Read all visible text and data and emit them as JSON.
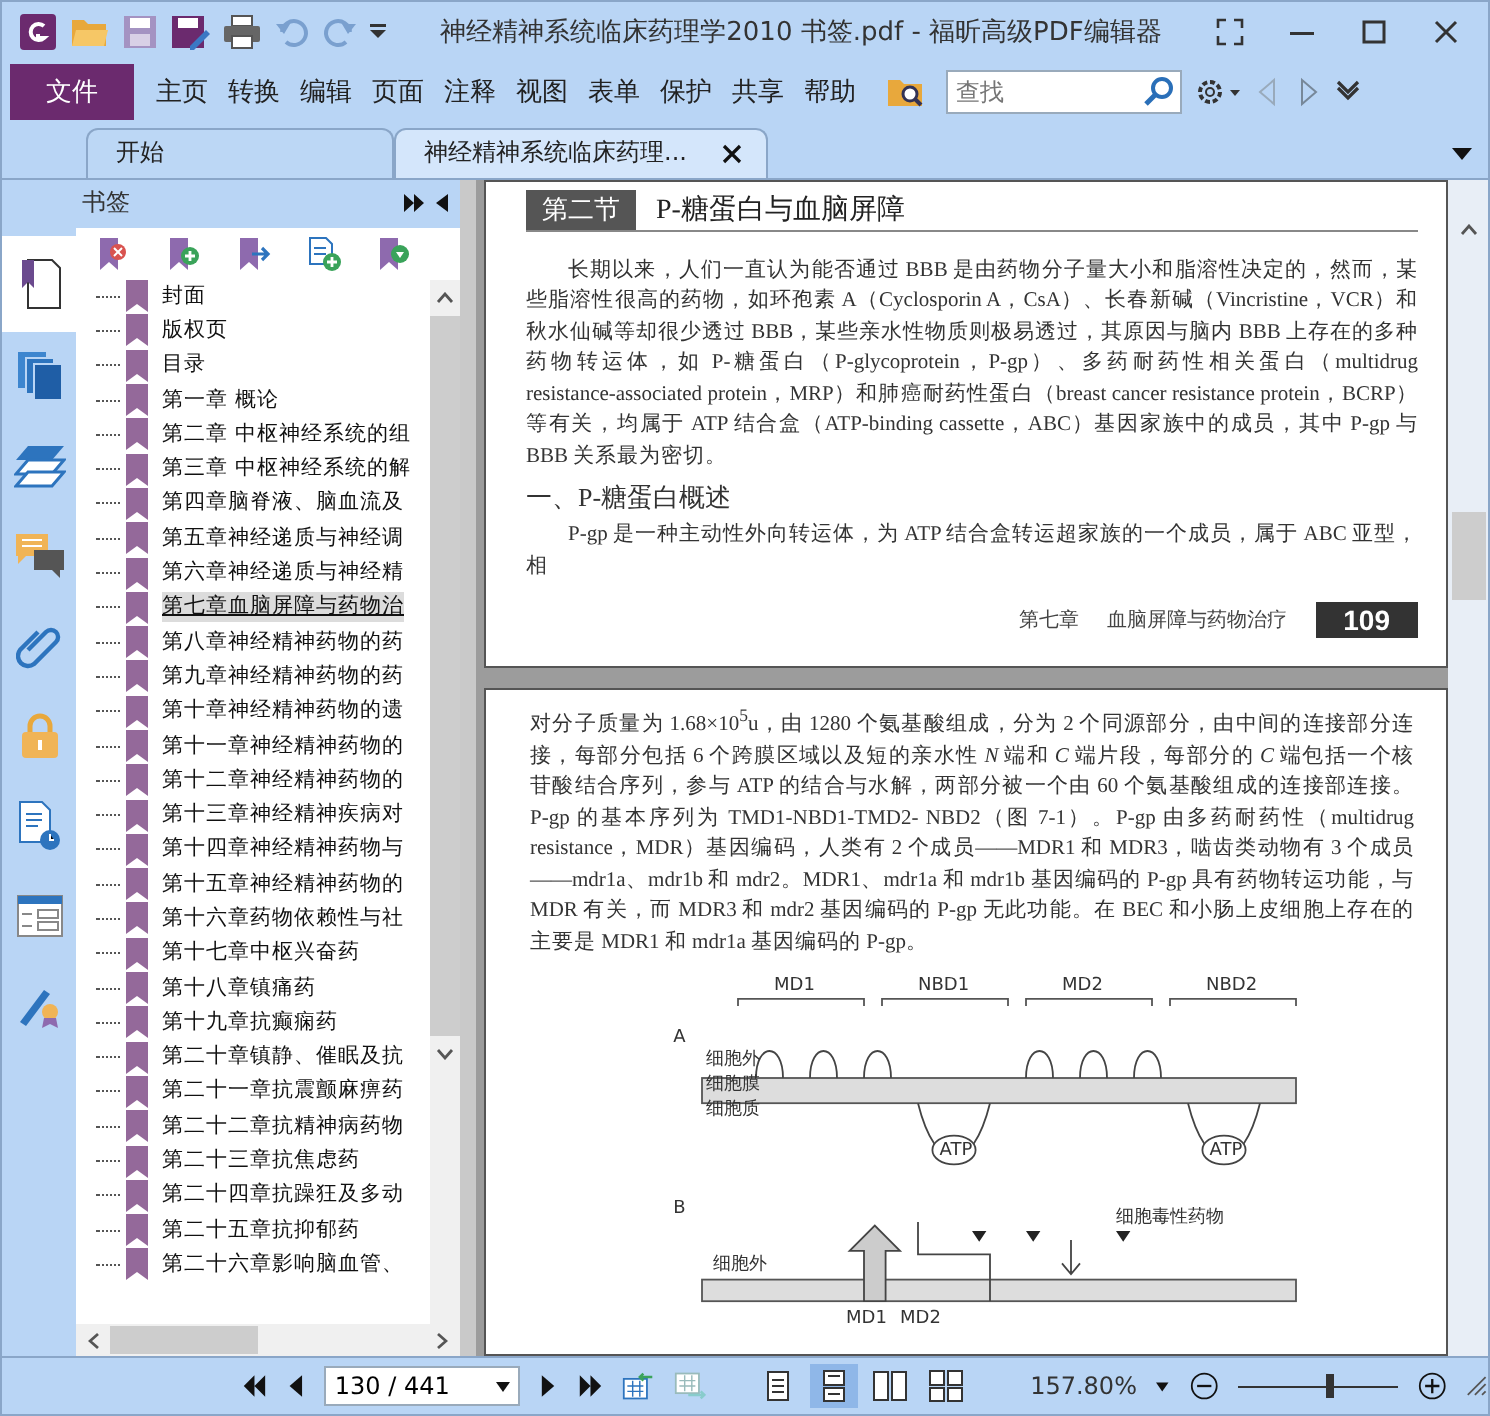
{
  "window": {
    "title": "神经精神系统临床药理学2010 书签.pdf - 福昕高级PDF编辑器"
  },
  "ribbon": {
    "file_button": "文件",
    "menus": [
      "主页",
      "转换",
      "编辑",
      "页面",
      "注释",
      "视图",
      "表单",
      "保护",
      "共享",
      "帮助"
    ]
  },
  "search": {
    "placeholder": "查找"
  },
  "tabs": [
    {
      "label": "开始",
      "selected": false,
      "closable": false
    },
    {
      "label": "神经精神系统临床药理...",
      "selected": true,
      "closable": true
    }
  ],
  "sidebar": {
    "title": "书签",
    "panels": [
      {
        "kind": "bookmarks",
        "selected": true
      },
      {
        "kind": "pages",
        "selected": false
      },
      {
        "kind": "layers",
        "selected": false
      },
      {
        "kind": "comments",
        "selected": false
      },
      {
        "kind": "attachments",
        "selected": false
      },
      {
        "kind": "security",
        "selected": false
      },
      {
        "kind": "history",
        "selected": false
      },
      {
        "kind": "form",
        "selected": false
      },
      {
        "kind": "signature",
        "selected": false
      }
    ],
    "bookmarks": [
      {
        "label": "封面",
        "selected": false
      },
      {
        "label": "版权页",
        "selected": false
      },
      {
        "label": "目录",
        "selected": false
      },
      {
        "label": "第一章 概论",
        "selected": false
      },
      {
        "label": "第二章 中枢神经系统的组",
        "selected": false
      },
      {
        "label": "第三章 中枢神经系统的解",
        "selected": false
      },
      {
        "label": "第四章脑脊液、脑血流及",
        "selected": false
      },
      {
        "label": "第五章神经递质与神经调",
        "selected": false
      },
      {
        "label": "第六章神经递质与神经精",
        "selected": false
      },
      {
        "label": "第七章血脑屏障与药物治",
        "selected": true
      },
      {
        "label": "第八章神经精神药物的药",
        "selected": false
      },
      {
        "label": "第九章神经精神药物的药",
        "selected": false
      },
      {
        "label": "第十章神经精神药物的遗",
        "selected": false
      },
      {
        "label": "第十一章神经精神药物的",
        "selected": false
      },
      {
        "label": "第十二章神经精神药物的",
        "selected": false
      },
      {
        "label": "第十三章神经精神疾病对",
        "selected": false
      },
      {
        "label": "第十四章神经精神药物与",
        "selected": false
      },
      {
        "label": "第十五章神经精神药物的",
        "selected": false
      },
      {
        "label": "第十六章药物依赖性与社",
        "selected": false
      },
      {
        "label": "第十七章中枢兴奋药",
        "selected": false
      },
      {
        "label": "第十八章镇痛药",
        "selected": false
      },
      {
        "label": "第十九章抗癫痫药",
        "selected": false
      },
      {
        "label": "第二十章镇静、催眠及抗",
        "selected": false
      },
      {
        "label": "第二十一章抗震颤麻痹药",
        "selected": false
      },
      {
        "label": "第二十二章抗精神病药物",
        "selected": false
      },
      {
        "label": "第二十三章抗焦虑药",
        "selected": false
      },
      {
        "label": "第二十四章抗躁狂及多动",
        "selected": false
      },
      {
        "label": "第二十五章抗抑郁药",
        "selected": false
      },
      {
        "label": "第二十六章影响脑血管、",
        "selected": false
      }
    ]
  },
  "document": {
    "page_1": {
      "section_tag": "第二节",
      "section_title": "P-糖蛋白与血脑屏障",
      "paragraph": "长期以来，人们一直认为能否通过 BBB 是由药物分子量大小和脂溶性决定的，然而，某些脂溶性很高的药物，如环孢素 A（Cyclosporin A，CsA）、长春新碱（Vincristine，VCR）和秋水仙碱等却很少透过 BBB，某些亲水性物质则极易透过，其原因与脑内 BBB 上存在的多种药物转运体，如 P-糖蛋白（P-glycoprotein，P-gp）、多药耐药性相关蛋白（multidrug resistance-associated protein，MRP）和肺癌耐药性蛋白（breast cancer resistance protein，BCRP）等有关，均属于 ATP 结合盒（ATP-binding cassette，ABC）基因家族中的成员，其中 P-gp 与 BBB 关系最为密切。",
      "subheading": "一、P-糖蛋白概述",
      "paragraph_2": "P-gp 是一种主动性外向转运体，为 ATP 结合盒转运超家族的一个成员，属于 ABC 亚型，相",
      "footer_chapter": "第七章",
      "footer_title": "血脑屏障与药物治疗",
      "page_number": "109"
    },
    "page_2": {
      "paragraph": "对分子质量为 1.68×10$^{5}$u，由 1280 个氨基酸组成，分为 2 个同源部分，由中间的连接部分连接，每部分包括 6 个跨膜区域以及短的亲水性 *N* 端和 *C* 端片段，每部分的 *C* 端包括一个核苷酸结合序列，参与 ATP 的结合与水解，两部分被一个由 60 个氨基酸组成的连接部连接。P-gp 的基本序列为 TMD1-NBD1-TMD2- NBD2（图 7-1）。P-gp 由多药耐药性（multidrug resistance，MDR）基因编码，人类有 2 个成员——MDR1 和 MDR3，啮齿类动物有 3 个成员——mdr1a、mdr1b 和 mdr2。MDR1、mdr1a 和 mdr1b 基因编码的 P-gp 具有药物转运功能，与 MDR 有关，而 MDR3 和 mdr2 基因编码的 P-gp 无此功能。在 BEC 和小肠上皮细胞上存在的主要是 MDR1 和 mdr1a 基因编码的 P-gp。",
      "figure": {
        "domains": [
          "MD1",
          "NBD1",
          "MD2",
          "NBD2"
        ],
        "panel_a": {
          "letter": "A",
          "layers": [
            "细胞外",
            "细胞膜",
            "细胞质"
          ],
          "atp": [
            "ATP",
            "ATP"
          ]
        },
        "panel_b": {
          "letter": "B",
          "outside": "细胞外",
          "drug": "细胞毒性药物",
          "domains": [
            "MD1",
            "MD2"
          ]
        }
      }
    }
  },
  "status_bar": {
    "page": "130 / 441",
    "view_modes": [
      {
        "kind": "single",
        "selected": false
      },
      {
        "kind": "continuous",
        "selected": true
      },
      {
        "kind": "facing",
        "selected": false
      },
      {
        "kind": "continuous-facing",
        "selected": false
      }
    ],
    "zoom": "157.80%",
    "zoom_slider": {
      "level": 0.58
    }
  }
}
